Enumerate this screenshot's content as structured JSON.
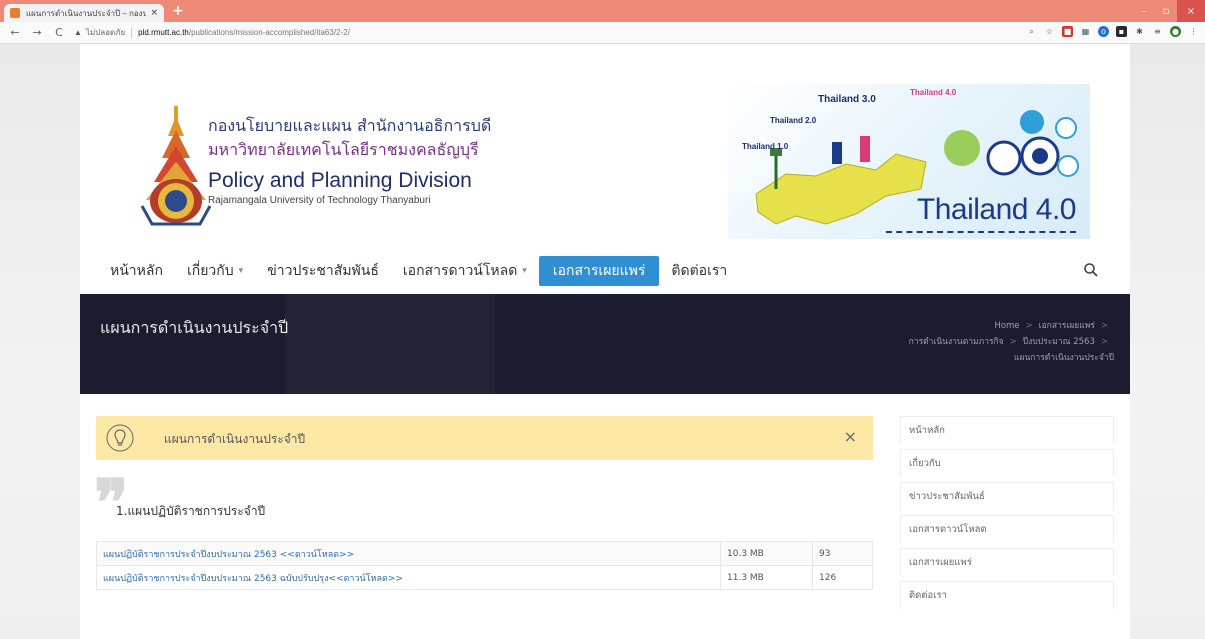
{
  "browser": {
    "tab_title": "แผนการดำเนินงานประจำปี – กองนโย...",
    "tab_close": "×",
    "new_tab": "+",
    "back": "←",
    "forward": "→",
    "reload": "C",
    "security_text": "ไม่ปลอดภัย",
    "url_host": "pld.rmutt.ac.th",
    "url_path": "/publications/mission-accomplished/ita63/2-2/",
    "win_min": "–",
    "win_max": "▫",
    "win_close": "×"
  },
  "header": {
    "org_thai_line1": "กองนโยบายและแผน สำนักงานอธิการบดี",
    "org_thai_line2": "มหาวิทยาลัยเทคโนโลยีราชมงคลธัญบุรี",
    "org_en": "Policy and Planning Division",
    "org_en_sub": "Rajamangala University of Technology Thanyaburi"
  },
  "banner": {
    "labels": [
      "Thailand 1.0",
      "Thailand 2.0",
      "Thailand 3.0",
      "Thailand 4.0"
    ],
    "big_text": "Thailand 4.0"
  },
  "nav": {
    "items": [
      {
        "label": "หน้าหลัก",
        "has_caret": false
      },
      {
        "label": "เกี่ยวกับ",
        "has_caret": true
      },
      {
        "label": "ข่าวประชาสัมพันธ์",
        "has_caret": false
      },
      {
        "label": "เอกสารดาวน์โหลด",
        "has_caret": true
      },
      {
        "label": "เอกสารเผยแพร่",
        "has_caret": false,
        "active": true
      },
      {
        "label": "ติดต่อเรา",
        "has_caret": false
      }
    ],
    "caret": "▾",
    "search_icon": "search-icon"
  },
  "title_band": {
    "page_title": "แผนการดำเนินงานประจำปี",
    "breadcrumb": [
      "Home",
      "เอกสารเผยแพร่",
      "การดำเนินงานตามภารกิจ",
      "ปีงบประมาณ 2563",
      "แผนการดำเนินงานประจำปี"
    ]
  },
  "content": {
    "notice_text": "แผนการดำเนินงานประจำปี",
    "notice_close": "×",
    "quote_mark": "❞",
    "section_heading": "1.แผนปฏิบัติราชการประจำปี",
    "files": [
      {
        "name": "แผนปฏิบัติราชการประจำปีงบประมาณ 2563 <<ดาวน์โหลด>>",
        "size": "10.3 MB",
        "count": "93"
      },
      {
        "name": "แผนปฏิบัติราชการประจำปีงบประมาณ 2563 ฉบับปรับปรุง<<ดาวน์โหลด>>",
        "size": "11.3 MB",
        "count": "126"
      }
    ]
  },
  "sidebar": {
    "items": [
      "หน้าหลัก",
      "เกี่ยวกับ",
      "ข่าวประชาสัมพันธ์",
      "เอกสารดาวน์โหลด",
      "เอกสารเผยแพร่",
      "ติดต่อเรา"
    ]
  },
  "colors": {
    "tabbar": "#ed8976",
    "nav_active": "#2f8fd1",
    "title_band": "#1b1c2e",
    "notice": "#fde8a6",
    "link": "#2f6bb3"
  }
}
